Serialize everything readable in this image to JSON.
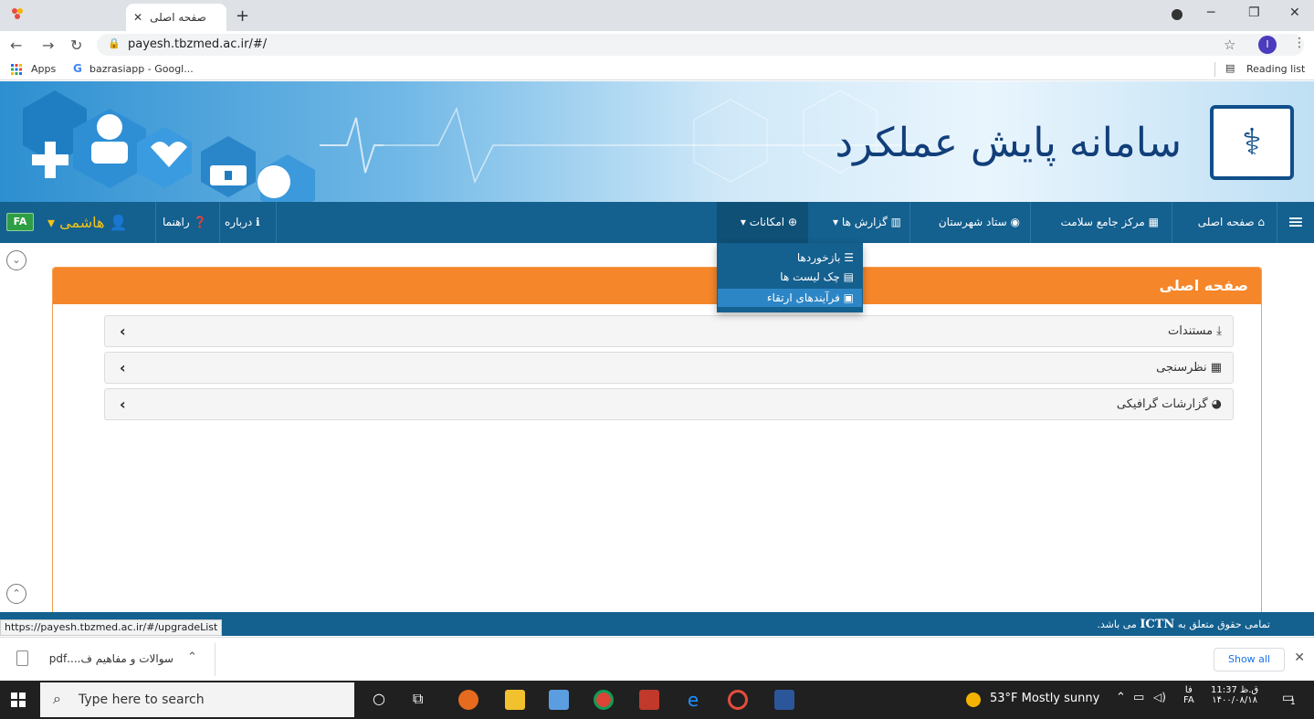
{
  "browser": {
    "tab_title": "صفحه اصلی",
    "url": "payesh.tbzmed.ac.ir/#/",
    "profile_initial": "I",
    "bookmarks": [
      {
        "label": "Apps"
      },
      {
        "label": "bazrasiapp - Googl..."
      }
    ],
    "reading_list_label": "Reading list"
  },
  "banner": {
    "title": "سامانه پایش عملکرد"
  },
  "navbar": {
    "items": [
      {
        "label": "صفحه اصلی",
        "icon": "home-icon"
      },
      {
        "label": "مرکز جامع سلامت",
        "icon": "building-icon"
      },
      {
        "label": "ستاد شهرستان",
        "icon": "circle-icon"
      },
      {
        "label": "گزارش ها",
        "icon": "chart-icon"
      },
      {
        "label": "امکانات",
        "icon": "globe-icon"
      }
    ],
    "left_items": [
      {
        "label": "درباره",
        "icon": "info-icon"
      },
      {
        "label": "راهنما",
        "icon": "question-icon"
      },
      {
        "label": "هاشمی",
        "icon": "user-icon"
      }
    ],
    "language": "FA"
  },
  "dropdown": {
    "items": [
      {
        "label": "بازخوردها",
        "icon": "list-icon"
      },
      {
        "label": "چک لیست ها",
        "icon": "table-icon"
      },
      {
        "label": "فرآیندهای ارتقاء",
        "icon": "image-icon",
        "active": true
      }
    ]
  },
  "panel": {
    "title": "صفحه اصلی",
    "accordion": [
      {
        "label": "مستندات",
        "icon": "download-icon"
      },
      {
        "label": "نظرسنجی",
        "icon": "grid-icon"
      },
      {
        "label": "گزارشات گرافیکی",
        "icon": "pie-chart-icon"
      }
    ]
  },
  "footer": {
    "text_before": "تمامی حقوق متعلق به",
    "brand": "ICTN",
    "text_after": "می باشد."
  },
  "status_url": "https://payesh.tbzmed.ac.ir/#/upgradeList",
  "downloads": {
    "file_label": "سوالات و مفاهیم ف....pdf",
    "show_all": "Show all"
  },
  "taskbar": {
    "search_placeholder": "Type here to search",
    "weather": "53°F  Mostly sunny",
    "lang": "FA",
    "lang_top": "فا",
    "time": "11:37 ق.ظ",
    "date": "۱۴۰۰/۰۸/۱۸",
    "notification_count": "1"
  },
  "colors": {
    "navbar": "#14608f",
    "panel_header": "#f5862a",
    "dropdown_active": "#2c86c6",
    "lang_badge": "#2e9e44"
  }
}
